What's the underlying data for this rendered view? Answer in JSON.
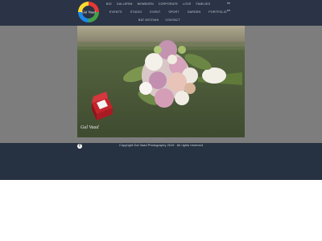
{
  "header": {
    "logo": {
      "name": "logo",
      "text": "Gal Vaad"
    },
    "nav_row1": [
      "Bio",
      "Gallerim",
      "Newborn",
      "Corporate",
      "Love",
      "Families"
    ],
    "nav_row2": [
      "Events",
      "Studio",
      "Event",
      "Sport",
      "Garden",
      "Portfolio"
    ],
    "nav_row3": [
      "Bat mitzvah",
      "Contact"
    ],
    "langs": [
      "he",
      "en"
    ]
  },
  "photo": {
    "alt": "Wedding bouquet and ring box",
    "watermark": "Gal Vaad"
  },
  "footer": {
    "copyright": "Copyright Gal Vaad Photography 2019 . All rights reserved",
    "social_icon": "facebook-icon"
  },
  "colors": {
    "header_bg": "#2a3446",
    "band_bg": "#7d7d7d",
    "footer_bg": "#263141"
  }
}
